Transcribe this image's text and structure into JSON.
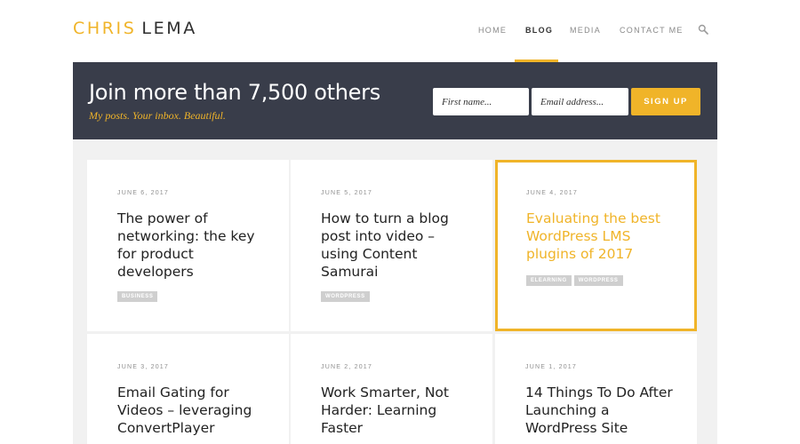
{
  "header": {
    "logo_first": "CHRIS",
    "logo_last": "LEMA",
    "nav": [
      "HOME",
      "BLOG",
      "MEDIA",
      "CONTACT ME"
    ],
    "active_nav": "BLOG",
    "search_icon": "search-icon"
  },
  "signup": {
    "title": "Join more than 7,500 others",
    "subtitle": "My posts. Your inbox. Beautiful.",
    "first_name_placeholder": "First name...",
    "email_placeholder": "Email address...",
    "button_label": "SIGN UP"
  },
  "posts": [
    {
      "date": "JUNE 6, 2017",
      "title": "The power of networking: the key for product developers",
      "tags": [
        "BUSINESS"
      ]
    },
    {
      "date": "JUNE 5, 2017",
      "title": "How to turn a blog post into video – using Content Samurai",
      "tags": [
        "WORDPRESS"
      ]
    },
    {
      "date": "JUNE 4, 2017",
      "title": "Evaluating the best WordPress LMS plugins of 2017",
      "tags": [
        "ELEARNING",
        "WORDPRESS"
      ],
      "featured": true
    },
    {
      "date": "JUNE 3, 2017",
      "title": "Email Gating for Videos – leveraging ConvertPlayer",
      "tags": []
    },
    {
      "date": "JUNE 2, 2017",
      "title": "Work Smarter, Not Harder: Learning Faster",
      "tags": []
    },
    {
      "date": "JUNE 1, 2017",
      "title": "14 Things To Do After Launching a WordPress Site",
      "tags": []
    }
  ],
  "colors": {
    "accent": "#f0b429",
    "banner": "#393d4a",
    "grid_bg": "#f1f1f1",
    "tag": "#cfcfcf"
  }
}
